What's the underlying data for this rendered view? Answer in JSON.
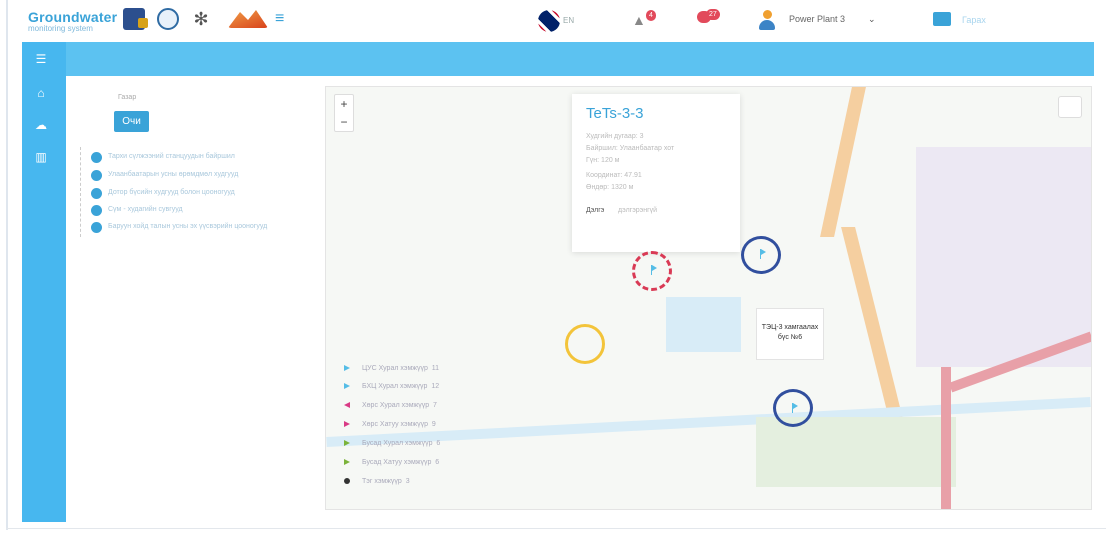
{
  "brand": {
    "title": "Groundwater",
    "subtitle": "monitoring system"
  },
  "header": {
    "lang_code": "EN",
    "notifications_count": "4",
    "messages_count": "27",
    "user_name": "Power Plant 3",
    "logout_label": "Гарах",
    "icons": [
      "institute-logo",
      "globe-logo",
      "emblem-logo",
      "mountain-logo",
      "wifi-logo",
      "uk-flag-icon",
      "bell-icon",
      "message-icon",
      "user-icon",
      "chevron-down-icon",
      "logout-icon"
    ]
  },
  "sidebar": {
    "icons": [
      "menu-icon",
      "home-icon",
      "cloud-icon",
      "chart-icon"
    ]
  },
  "panel": {
    "small_label": "Газар",
    "button_label": "Очи",
    "tree_items": [
      "Тархи сүлжээний станцуудын байршил",
      "Улаанбаатарын усны өрөмдмөл худгууд",
      "Дотор бүсийн худгууд болон цооногууд",
      "Сүм - худагийн сувгууд",
      "Баруун хойд талын усны эх үүсвэрийн цооногууд"
    ]
  },
  "map": {
    "popup": {
      "title": "TeTs-3-3",
      "lines": [
        "Худгийн дугаар: 3",
        "Байршил: Улаанбаатар хот",
        "Гүн: 120 м",
        "Координат: 47.91",
        "Өндөр: 1320 м"
      ],
      "more_label": "Дэлгэ",
      "more_value": "дэлгэрэнгүй"
    },
    "station_label": "ТЭЦ-3 хамгаалах бүс №6",
    "legend": [
      {
        "label": "ЦУС Хурал хэмжүүр",
        "count": "11",
        "color": "#55bde6"
      },
      {
        "label": "БХЦ Хурал хэмжүүр",
        "count": "12",
        "color": "#55bde6"
      },
      {
        "label": "Хөрс Хурал хэмжүүр",
        "count": "7",
        "color": "#d93a85"
      },
      {
        "label": "Хөрс Хатуу хэмжүүр",
        "count": "9",
        "color": "#d93a85"
      },
      {
        "label": "Бусад Хурал хэмжүүр",
        "count": "6",
        "color": "#7bb33a"
      },
      {
        "label": "Бусад Хатуу хэмжүүр",
        "count": "6",
        "color": "#7bb33a"
      },
      {
        "label": "Тэг хэмжүүр",
        "count": "3",
        "color": "#333333"
      }
    ]
  }
}
